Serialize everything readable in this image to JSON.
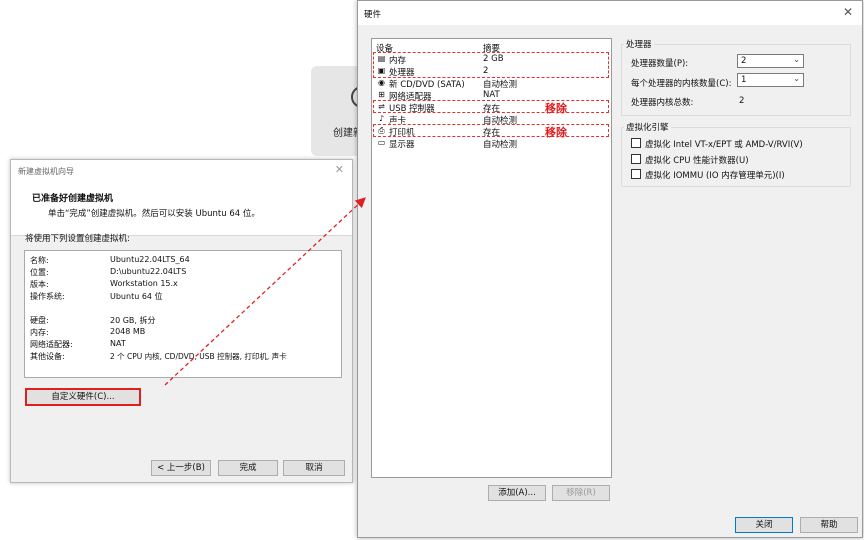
{
  "background_card": {
    "label": "创建新"
  },
  "wizard": {
    "title": "新建虚拟机向导",
    "heading": "已准备好创建虚拟机",
    "subheading": "单击“完成”创建虚拟机。然后可以安装 Ubuntu 64 位。",
    "settings_label": "将使用下列设置创建虚拟机:",
    "summary": [
      {
        "key": "名称:",
        "value": "Ubuntu22.04LTS_64"
      },
      {
        "key": "位置:",
        "value": "D:\\ubuntu22.04LTS"
      },
      {
        "key": "版本:",
        "value": "Workstation 15.x"
      },
      {
        "key": "操作系统:",
        "value": "Ubuntu 64 位"
      },
      {
        "key": "硬盘:",
        "value": "20 GB, 拆分"
      },
      {
        "key": "内存:",
        "value": "2048 MB"
      },
      {
        "key": "网络适配器:",
        "value": "NAT"
      },
      {
        "key": "其他设备:",
        "value": "2 个 CPU 内核, CD/DVD, USB 控制器, 打印机, 声卡"
      }
    ],
    "customize_button": "自定义硬件(C)...",
    "back_button": "< 上一步(B)",
    "finish_button": "完成",
    "cancel_button": "取消"
  },
  "hardware": {
    "title": "硬件",
    "col_device": "设备",
    "col_summary": "摘要",
    "devices": [
      {
        "icon": "memory-icon",
        "glyph": "▤",
        "name": "内存",
        "summary": "2 GB"
      },
      {
        "icon": "processor-icon",
        "glyph": "▣",
        "name": "处理器",
        "summary": "2"
      },
      {
        "icon": "cd-dvd-icon",
        "glyph": "◉",
        "name": "新 CD/DVD (SATA)",
        "summary": "自动检测"
      },
      {
        "icon": "network-adapter-icon",
        "glyph": "⊞",
        "name": "网络适配器",
        "summary": "NAT"
      },
      {
        "icon": "usb-icon",
        "glyph": "⇌",
        "name": "USB 控制器",
        "summary": "存在"
      },
      {
        "icon": "sound-card-icon",
        "glyph": "♪",
        "name": "声卡",
        "summary": "自动检测"
      },
      {
        "icon": "printer-icon",
        "glyph": "⎙",
        "name": "打印机",
        "summary": "存在"
      },
      {
        "icon": "display-icon",
        "glyph": "▭",
        "name": "显示器",
        "summary": "自动检测"
      }
    ],
    "remove_annotation_1": "移除",
    "remove_annotation_2": "移除",
    "add_button": "添加(A)...",
    "remove_button": "移除(R)",
    "processor_group": "处理器",
    "processor_count_label": "处理器数量(P):",
    "processor_count_value": "2",
    "cores_label": "每个处理器的内核数量(C):",
    "cores_value": "1",
    "total_cores_label": "处理器内核总数:",
    "total_cores_value": "2",
    "virt_group": "虚拟化引擎",
    "virt_options": [
      "虚拟化 Intel VT-x/EPT 或 AMD-V/RVI(V)",
      "虚拟化 CPU 性能计数器(U)",
      "虚拟化 IOMMU (IO 内存管理单元)(I)"
    ],
    "close_button": "关闭",
    "help_button": "帮助"
  },
  "colors": {
    "annotation_red": "#e02020",
    "dialog_bg": "#f0f0f0"
  }
}
